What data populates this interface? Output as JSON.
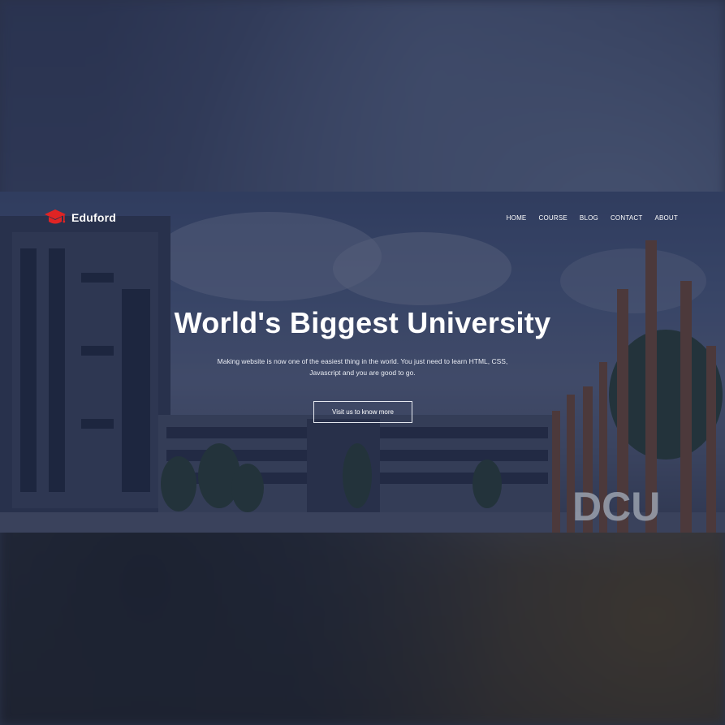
{
  "brand": {
    "name": "Eduford",
    "icon": "graduation-cap-icon",
    "icon_color": "#e02424"
  },
  "nav": {
    "items": [
      {
        "label": "HOME"
      },
      {
        "label": "COURSE"
      },
      {
        "label": "BLOG"
      },
      {
        "label": "CONTACT"
      },
      {
        "label": "ABOUT"
      }
    ]
  },
  "hero": {
    "title": "World's Biggest University",
    "subtitle_line1": "Making website is now one of the easiest thing in the world. You just need to learn HTML, CSS,",
    "subtitle_line2": "Javascript and you are good to go.",
    "cta_label": "Visit us to know more",
    "campus_sign": "DCU"
  },
  "colors": {
    "overlay": "#141c3c",
    "accent": "#e02424",
    "text": "#ffffff"
  }
}
